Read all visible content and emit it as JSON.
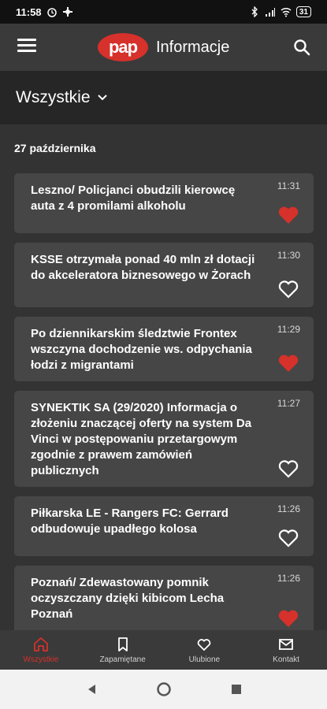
{
  "status_bar": {
    "time": "11:58",
    "battery": "31"
  },
  "app_bar": {
    "logo_text": "pap",
    "title": "Informacje"
  },
  "filter": {
    "selected": "Wszystkie"
  },
  "date_header": "27 października",
  "articles": [
    {
      "title": "Leszno/ Policjanci obudzili kierowcę auta z 4 promilami alkoholu",
      "time": "11:31",
      "favorite": true
    },
    {
      "title": "KSSE otrzymała ponad 40 mln zł dotacji do akceleratora biznesowego w Żorach",
      "time": "11:30",
      "favorite": false
    },
    {
      "title": "Po dziennikarskim śledztwie Frontex wszczyna dochodzenie ws. odpychania łodzi z migrantami",
      "time": "11:29",
      "favorite": true
    },
    {
      "title": "SYNEKTIK SA (29/2020) Informacja o złożeniu znaczącej oferty na system Da Vinci w postępowaniu przetargowym zgodnie z prawem zamówień publicznych",
      "time": "11:27",
      "favorite": false
    },
    {
      "title": "Piłkarska LE - Rangers FC: Gerrard odbudowuje upadłego kolosa",
      "time": "11:26",
      "favorite": false
    },
    {
      "title": "Poznań/ Zdewastowany pomnik oczyszczany dzięki kibicom Lecha Poznań",
      "time": "11:26",
      "favorite": true
    }
  ],
  "bottom_nav": [
    {
      "label": "Wszystkie",
      "icon": "home-icon",
      "active": true
    },
    {
      "label": "Zapamiętane",
      "icon": "bookmark-icon",
      "active": false
    },
    {
      "label": "Ulubione",
      "icon": "heart-icon",
      "active": false
    },
    {
      "label": "Kontakt",
      "icon": "mail-icon",
      "active": false
    }
  ],
  "colors": {
    "accent": "#d6312b",
    "background": "#333333",
    "card": "#464646",
    "appbar": "#3a3a3a"
  }
}
